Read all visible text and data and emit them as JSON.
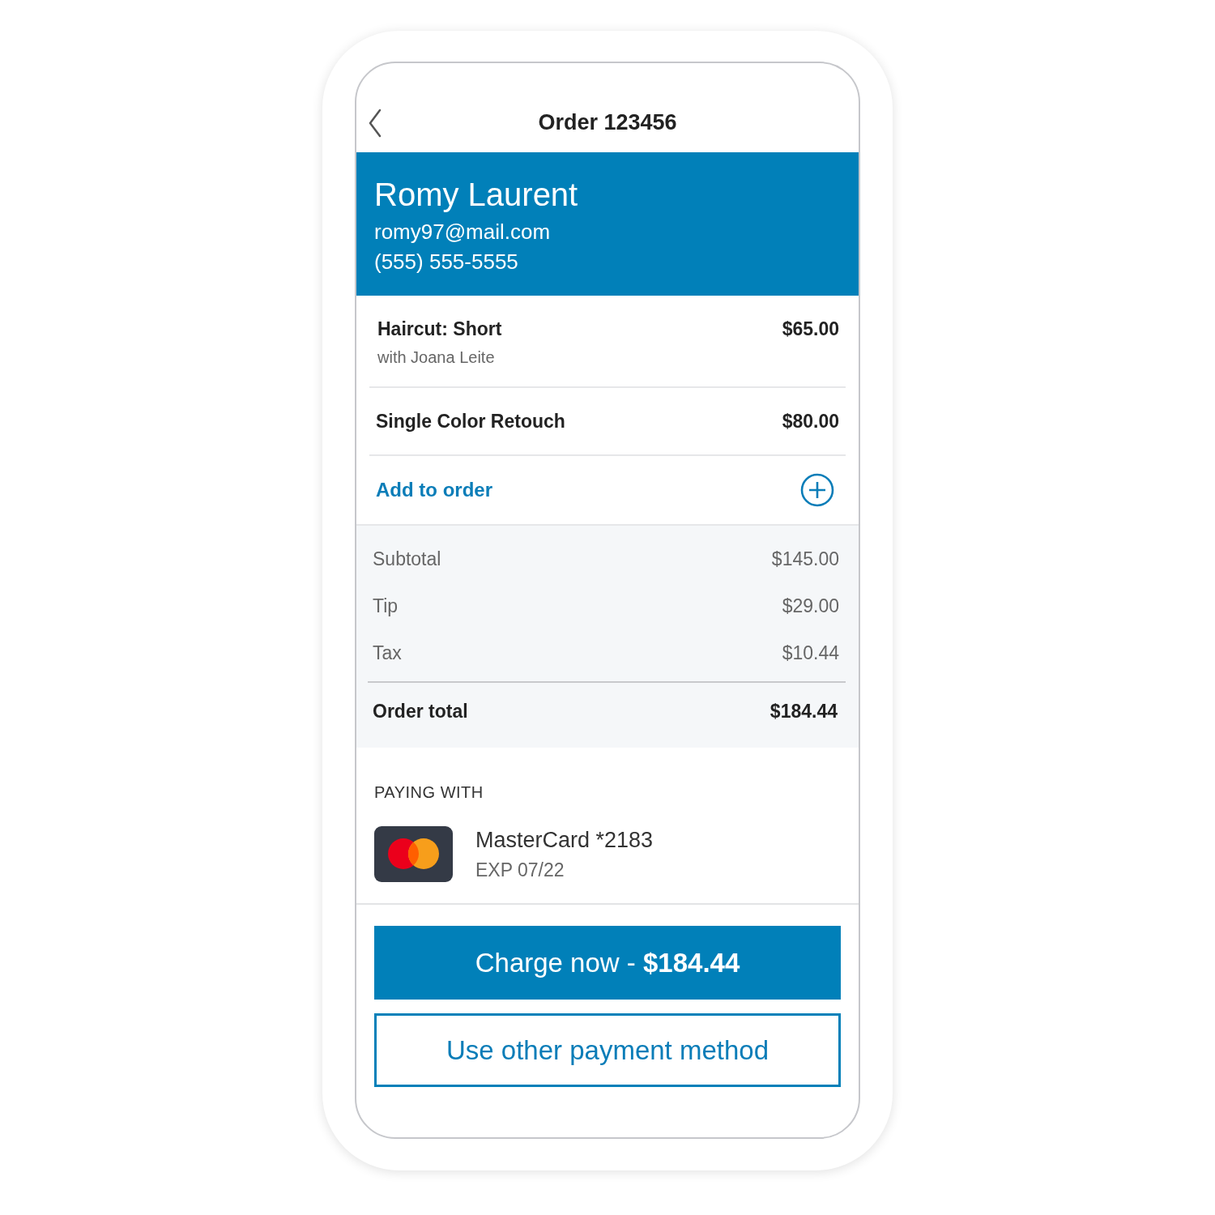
{
  "header": {
    "title": "Order 123456"
  },
  "customer": {
    "name": "Romy Laurent",
    "email": "romy97@mail.com",
    "phone": "(555) 555-5555"
  },
  "items": [
    {
      "name": "Haircut: Short",
      "detail": "with Joana Leite",
      "price": "$65.00"
    },
    {
      "name": "Single Color Retouch",
      "price": "$80.00"
    }
  ],
  "add_item": {
    "label": "Add to order"
  },
  "summary": [
    {
      "label": "Subtotal",
      "amount": "$145.00"
    },
    {
      "label": "Tip",
      "amount": "$29.00"
    },
    {
      "label": "Tax",
      "amount": "$10.44"
    }
  ],
  "total": {
    "label": "Order total",
    "amount": "$184.44"
  },
  "payment": {
    "heading": "PAYING WITH",
    "card": "MasterCard *2183",
    "expiry": "EXP 07/22"
  },
  "buttons": [
    {
      "kind": "primary",
      "label": "Charge now - **$184.44**"
    },
    {
      "kind": "outline",
      "label": "Use other payment method"
    }
  ]
}
